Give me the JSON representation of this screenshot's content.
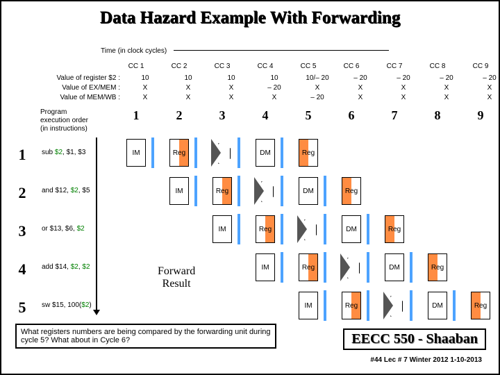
{
  "title": "Data Hazard Example With Forwarding",
  "time_label": "Time (in clock cycles)",
  "cc": [
    "CC 1",
    "CC 2",
    "CC 3",
    "CC 4",
    "CC 5",
    "CC 6",
    "CC 7",
    "CC 8",
    "CC 9"
  ],
  "reg_labels": [
    "Value of register $2 :",
    "Value of EX/MEM :",
    "Value of MEM/WB :"
  ],
  "reg_vals": {
    "r2": [
      "10",
      "10",
      "10",
      "10",
      "10/– 20",
      "– 20",
      "– 20",
      "– 20",
      "– 20"
    ],
    "ex": [
      "X",
      "X",
      "X",
      "– 20",
      "X",
      "X",
      "X",
      "X",
      "X"
    ],
    "mem": [
      "X",
      "X",
      "X",
      "X",
      "– 20",
      "X",
      "X",
      "X",
      "X"
    ]
  },
  "instno": [
    "1",
    "2",
    "3",
    "4",
    "5",
    "6",
    "7",
    "8",
    "9"
  ],
  "peo": "Program\nexecution order\n(in instructions)",
  "rows": [
    {
      "n": "1",
      "pre": "sub ",
      "g1": "$2",
      "mid": ", $1, $3",
      "g2": "",
      "post": ""
    },
    {
      "n": "2",
      "pre": "and $12, ",
      "g1": "$2",
      "mid": ", $5",
      "g2": "",
      "post": ""
    },
    {
      "n": "3",
      "pre": "or $13, $6, ",
      "g1": "$2",
      "mid": "",
      "g2": "",
      "post": ""
    },
    {
      "n": "4",
      "pre": "add $14, ",
      "g1": "$2",
      "mid": ", ",
      "g2": "$2",
      "post": ""
    },
    {
      "n": "5",
      "pre": "sw $15, 100(",
      "g1": "$2",
      "mid": ")",
      "g2": "",
      "post": ""
    }
  ],
  "stages": {
    "im": "IM",
    "reg": "Reg",
    "dm": "DM"
  },
  "fwd": "Forward\nResult",
  "question": "What registers numbers are being compared by the forwarding unit during cycle 5?  What about in Cycle 6?",
  "eecc": "EECC 550 - Shaaban",
  "footer": "#44  Lec # 7  Winter 2012  1-10-2013",
  "chart_data": {
    "type": "table",
    "title": "Pipeline timing with forwarding",
    "cycles": 9,
    "instructions": [
      {
        "n": 1,
        "asm": "sub $2, $1, $3",
        "start": 1
      },
      {
        "n": 2,
        "asm": "and $12, $2, $5",
        "start": 2
      },
      {
        "n": 3,
        "asm": "or $13, $6, $2",
        "start": 3
      },
      {
        "n": 4,
        "asm": "add $14, $2, $2",
        "start": 4
      },
      {
        "n": 5,
        "asm": "sw $15, 100($2)",
        "start": 5
      }
    ],
    "stage_sequence": [
      "IM",
      "Reg",
      "ALU",
      "DM",
      "Reg"
    ],
    "register_trace": {
      "$2": [
        10,
        10,
        10,
        10,
        "10/-20",
        -20,
        -20,
        -20,
        -20
      ],
      "EX/MEM": [
        "X",
        "X",
        "X",
        -20,
        "X",
        "X",
        "X",
        "X",
        "X"
      ],
      "MEM/WB": [
        "X",
        "X",
        "X",
        "X",
        -20,
        "X",
        "X",
        "X",
        "X"
      ]
    }
  }
}
